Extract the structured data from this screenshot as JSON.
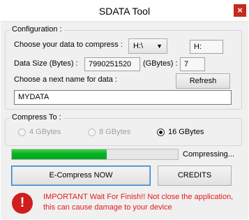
{
  "window": {
    "title": "SDATA Tool",
    "close_glyph": "×"
  },
  "configuration": {
    "group_label": "Configuration :",
    "choose_label": "Choose your data to compress :",
    "drive_selected": "H:\\",
    "drive_display": "H:",
    "size_label": "Data Size (Bytes) :",
    "size_bytes": "7990251520",
    "gbytes_label": "(GBytes) :",
    "size_gbytes": "7",
    "next_name_label": "Choose a next name for data :",
    "refresh_label": "Refresh",
    "name_value": "MYDATA"
  },
  "compress_to": {
    "group_label": "Compress To :",
    "options": [
      {
        "label": "4 GBytes",
        "checked": false,
        "enabled": false
      },
      {
        "label": "8 GBytes",
        "checked": false,
        "enabled": false
      },
      {
        "label": "16 GBytes",
        "checked": true,
        "enabled": true
      }
    ]
  },
  "progress": {
    "fraction": 0.57,
    "status": "Compressing...",
    "color": "#06b025"
  },
  "actions": {
    "compress_label": "E-Compress NOW",
    "credits_label": "CREDITS"
  },
  "warning": {
    "icon": "error-icon",
    "glyph": "!",
    "line1": "IMPORTANT Wait For Finish!! Not close the application,",
    "line2": "this can cause damage to your device",
    "color": "#e21c1c"
  }
}
